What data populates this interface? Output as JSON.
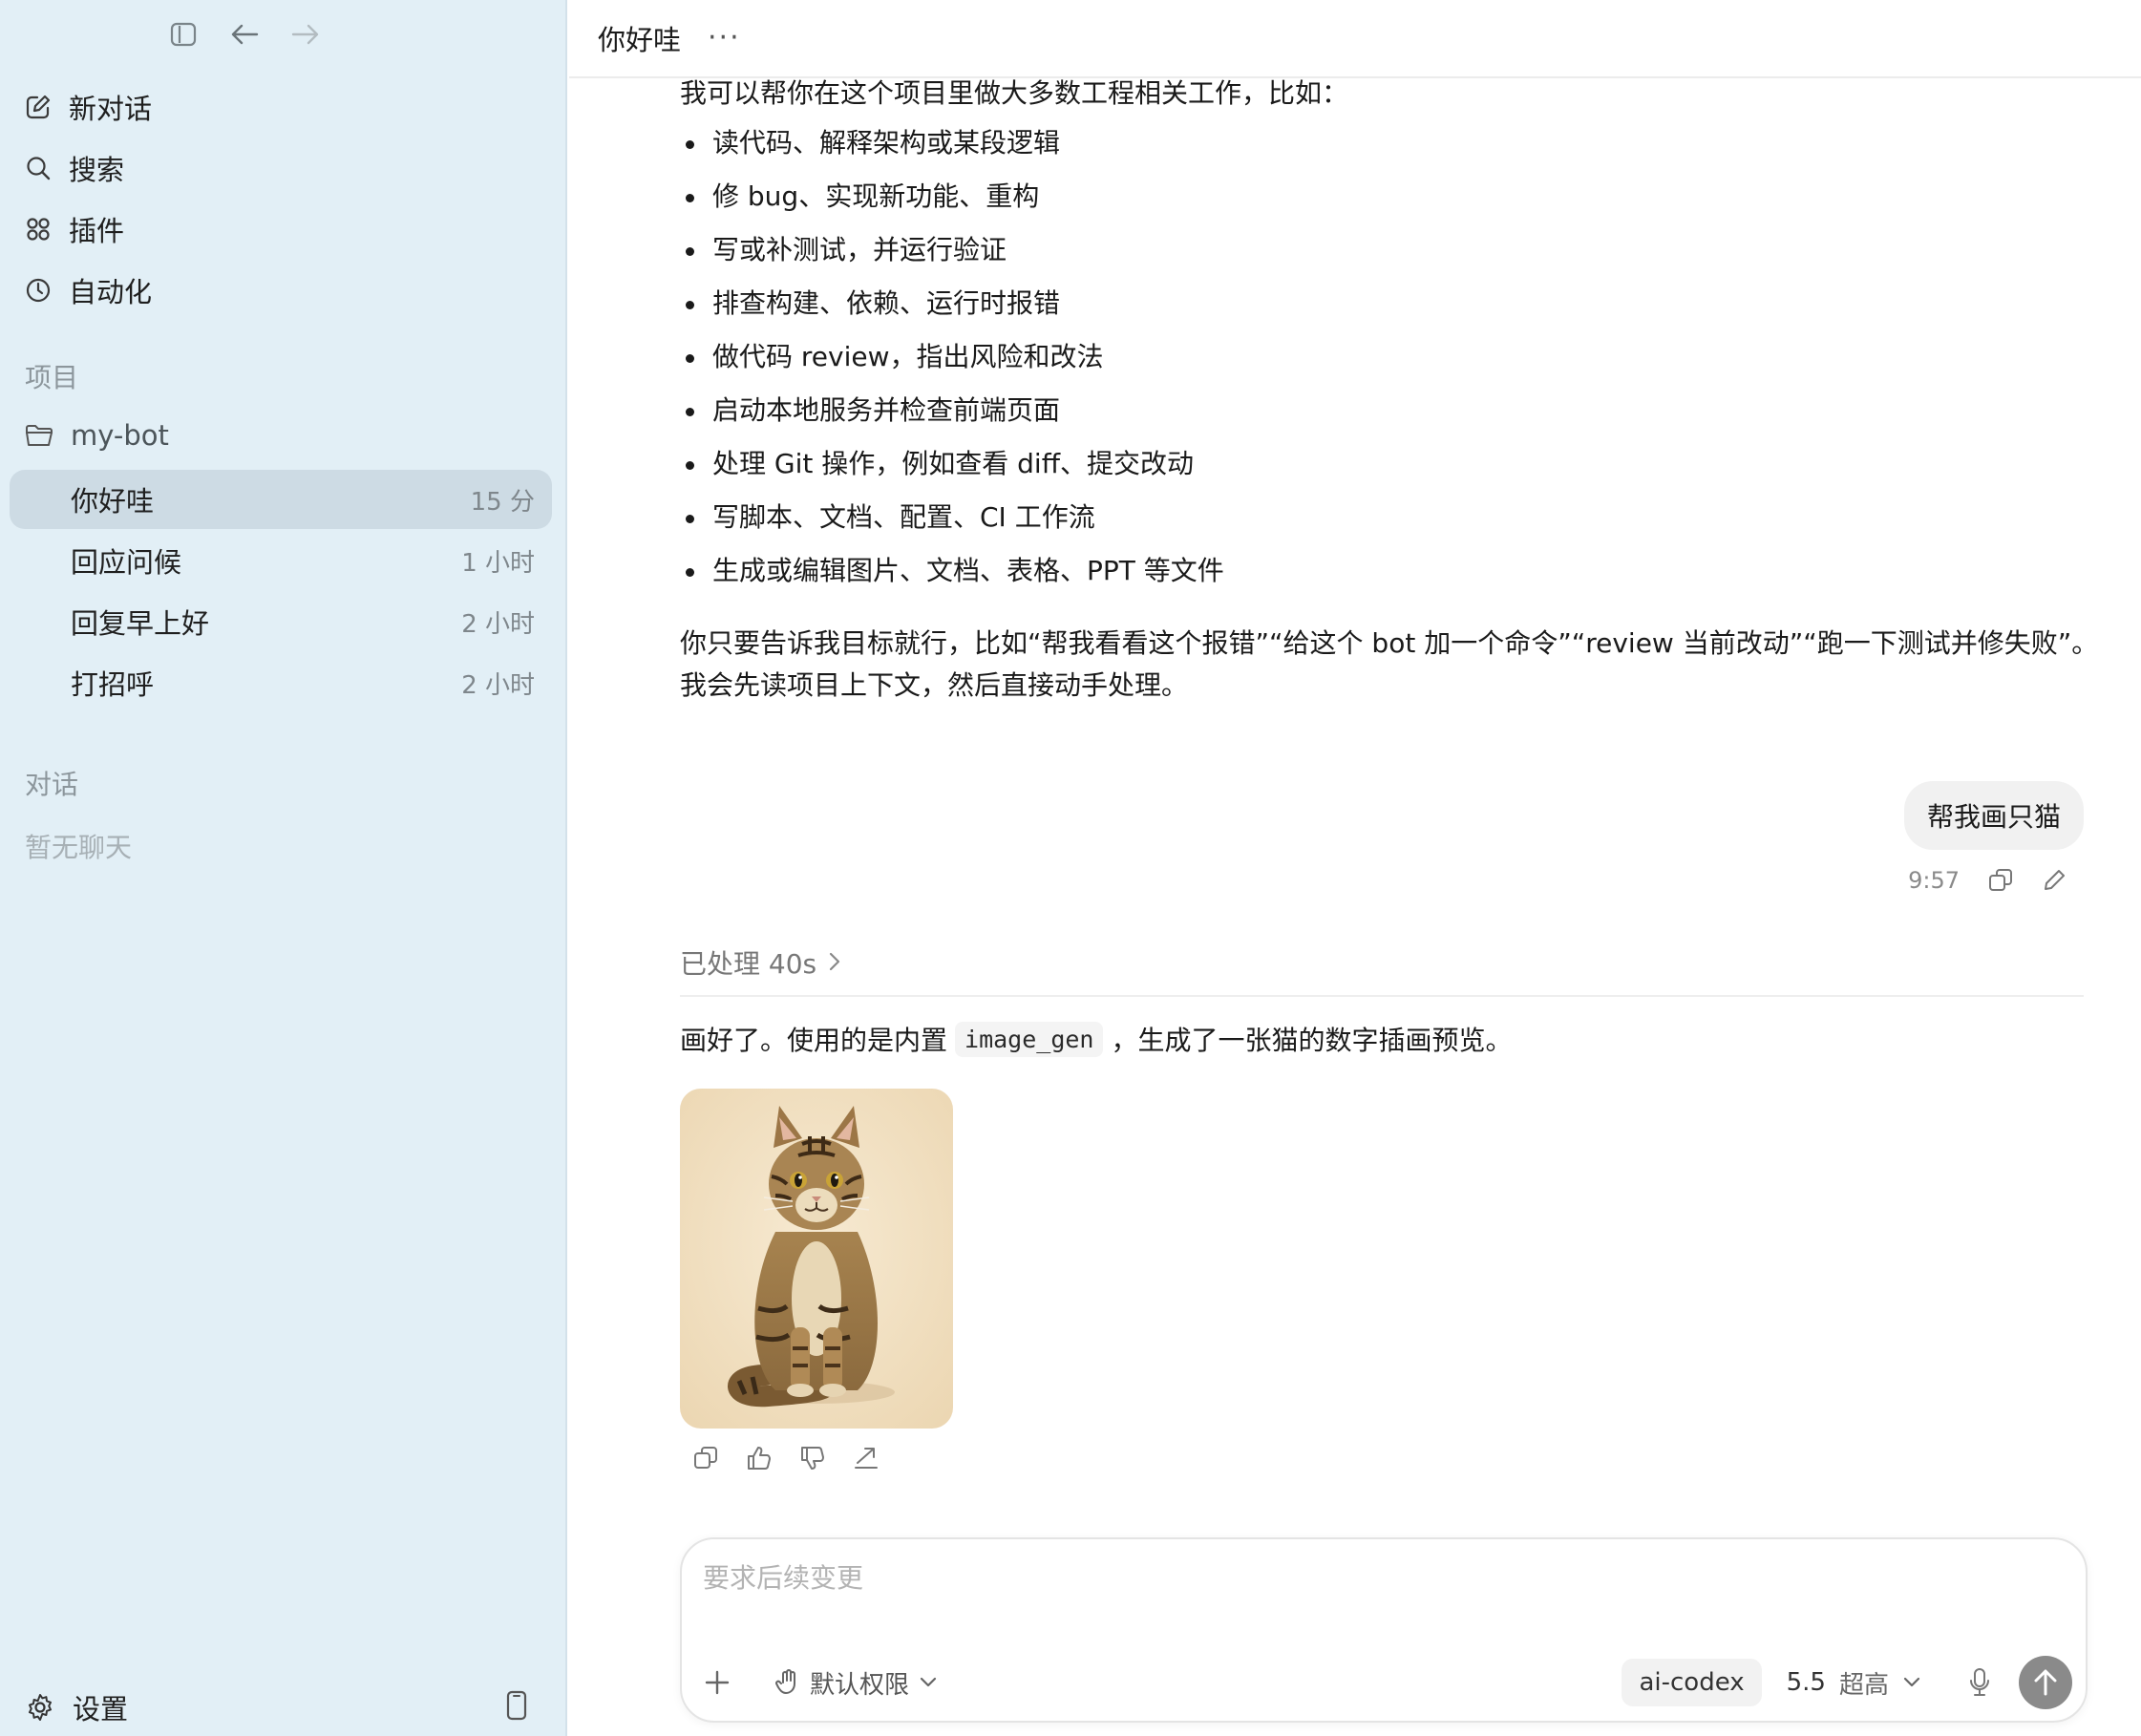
{
  "sidebar": {
    "nav": [
      {
        "label": "新对话",
        "icon": "new-chat-icon"
      },
      {
        "label": "搜索",
        "icon": "search-icon"
      },
      {
        "label": "插件",
        "icon": "plugins-icon"
      },
      {
        "label": "自动化",
        "icon": "clock-icon"
      }
    ],
    "projects_title": "项目",
    "project_name": "my-bot",
    "chats": [
      {
        "title": "你好哇",
        "time": "15 分"
      },
      {
        "title": "回应问候",
        "time": "1 小时"
      },
      {
        "title": "回复早上好",
        "time": "2 小时"
      },
      {
        "title": "打招呼",
        "time": "2 小时"
      }
    ],
    "conversations_title": "对话",
    "empty_conversations": "暂无聊天",
    "settings_label": "设置"
  },
  "header": {
    "title": "你好哇",
    "more": "···"
  },
  "conversation": {
    "intro": "我可以帮你在这个项目里做大多数工程相关工作，比如：",
    "capabilities": [
      "读代码、解释架构或某段逻辑",
      "修 bug、实现新功能、重构",
      "写或补测试，并运行验证",
      "排查构建、依赖、运行时报错",
      "做代码 review，指出风险和改法",
      "启动本地服务并检查前端页面",
      "处理 Git 操作，例如查看 diff、提交改动",
      "写脚本、文档、配置、CI 工作流",
      "生成或编辑图片、文档、表格、PPT 等文件"
    ],
    "paragraph_line1": "你只要告诉我目标就行，比如“帮我看看这个报错”“给这个 bot 加一个命令”“review 当前改动”“跑一下测试并修失败”。",
    "paragraph_line2": "我会先读项目上下文，然后直接动手处理。",
    "user_message": "帮我画只猫",
    "user_message_time": "9:57",
    "processed_label": "已处理 40s",
    "reply_before": "画好了。使用的是内置",
    "reply_code": "image_gen",
    "reply_after": "，生成了一张猫的数字插画预览。"
  },
  "composer": {
    "placeholder": "要求后续变更",
    "permission": "默认权限",
    "model": "ai-codex",
    "version": "5.5",
    "level": "超高"
  },
  "colors": {
    "sidebar_bg": "#e2eff6",
    "active_chat_bg": "#cddbe4",
    "send_button": "#8a8a8a"
  }
}
